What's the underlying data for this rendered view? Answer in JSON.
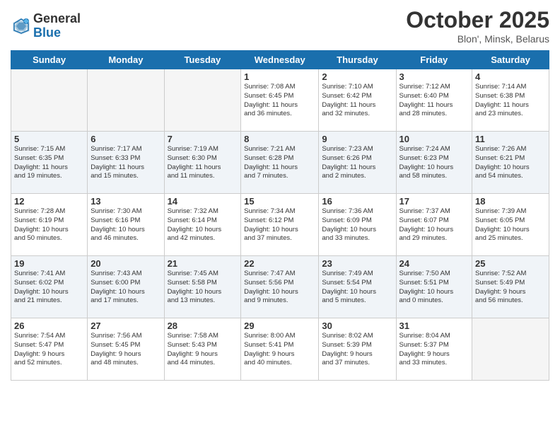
{
  "header": {
    "logo_general": "General",
    "logo_blue": "Blue",
    "month_title": "October 2025",
    "location": "Blon', Minsk, Belarus"
  },
  "days_of_week": [
    "Sunday",
    "Monday",
    "Tuesday",
    "Wednesday",
    "Thursday",
    "Friday",
    "Saturday"
  ],
  "weeks": [
    {
      "days": [
        {
          "num": "",
          "info": ""
        },
        {
          "num": "",
          "info": ""
        },
        {
          "num": "",
          "info": ""
        },
        {
          "num": "1",
          "info": "Sunrise: 7:08 AM\nSunset: 6:45 PM\nDaylight: 11 hours\nand 36 minutes."
        },
        {
          "num": "2",
          "info": "Sunrise: 7:10 AM\nSunset: 6:42 PM\nDaylight: 11 hours\nand 32 minutes."
        },
        {
          "num": "3",
          "info": "Sunrise: 7:12 AM\nSunset: 6:40 PM\nDaylight: 11 hours\nand 28 minutes."
        },
        {
          "num": "4",
          "info": "Sunrise: 7:14 AM\nSunset: 6:38 PM\nDaylight: 11 hours\nand 23 minutes."
        }
      ]
    },
    {
      "days": [
        {
          "num": "5",
          "info": "Sunrise: 7:15 AM\nSunset: 6:35 PM\nDaylight: 11 hours\nand 19 minutes."
        },
        {
          "num": "6",
          "info": "Sunrise: 7:17 AM\nSunset: 6:33 PM\nDaylight: 11 hours\nand 15 minutes."
        },
        {
          "num": "7",
          "info": "Sunrise: 7:19 AM\nSunset: 6:30 PM\nDaylight: 11 hours\nand 11 minutes."
        },
        {
          "num": "8",
          "info": "Sunrise: 7:21 AM\nSunset: 6:28 PM\nDaylight: 11 hours\nand 7 minutes."
        },
        {
          "num": "9",
          "info": "Sunrise: 7:23 AM\nSunset: 6:26 PM\nDaylight: 11 hours\nand 2 minutes."
        },
        {
          "num": "10",
          "info": "Sunrise: 7:24 AM\nSunset: 6:23 PM\nDaylight: 10 hours\nand 58 minutes."
        },
        {
          "num": "11",
          "info": "Sunrise: 7:26 AM\nSunset: 6:21 PM\nDaylight: 10 hours\nand 54 minutes."
        }
      ]
    },
    {
      "days": [
        {
          "num": "12",
          "info": "Sunrise: 7:28 AM\nSunset: 6:19 PM\nDaylight: 10 hours\nand 50 minutes."
        },
        {
          "num": "13",
          "info": "Sunrise: 7:30 AM\nSunset: 6:16 PM\nDaylight: 10 hours\nand 46 minutes."
        },
        {
          "num": "14",
          "info": "Sunrise: 7:32 AM\nSunset: 6:14 PM\nDaylight: 10 hours\nand 42 minutes."
        },
        {
          "num": "15",
          "info": "Sunrise: 7:34 AM\nSunset: 6:12 PM\nDaylight: 10 hours\nand 37 minutes."
        },
        {
          "num": "16",
          "info": "Sunrise: 7:36 AM\nSunset: 6:09 PM\nDaylight: 10 hours\nand 33 minutes."
        },
        {
          "num": "17",
          "info": "Sunrise: 7:37 AM\nSunset: 6:07 PM\nDaylight: 10 hours\nand 29 minutes."
        },
        {
          "num": "18",
          "info": "Sunrise: 7:39 AM\nSunset: 6:05 PM\nDaylight: 10 hours\nand 25 minutes."
        }
      ]
    },
    {
      "days": [
        {
          "num": "19",
          "info": "Sunrise: 7:41 AM\nSunset: 6:02 PM\nDaylight: 10 hours\nand 21 minutes."
        },
        {
          "num": "20",
          "info": "Sunrise: 7:43 AM\nSunset: 6:00 PM\nDaylight: 10 hours\nand 17 minutes."
        },
        {
          "num": "21",
          "info": "Sunrise: 7:45 AM\nSunset: 5:58 PM\nDaylight: 10 hours\nand 13 minutes."
        },
        {
          "num": "22",
          "info": "Sunrise: 7:47 AM\nSunset: 5:56 PM\nDaylight: 10 hours\nand 9 minutes."
        },
        {
          "num": "23",
          "info": "Sunrise: 7:49 AM\nSunset: 5:54 PM\nDaylight: 10 hours\nand 5 minutes."
        },
        {
          "num": "24",
          "info": "Sunrise: 7:50 AM\nSunset: 5:51 PM\nDaylight: 10 hours\nand 0 minutes."
        },
        {
          "num": "25",
          "info": "Sunrise: 7:52 AM\nSunset: 5:49 PM\nDaylight: 9 hours\nand 56 minutes."
        }
      ]
    },
    {
      "days": [
        {
          "num": "26",
          "info": "Sunrise: 7:54 AM\nSunset: 5:47 PM\nDaylight: 9 hours\nand 52 minutes."
        },
        {
          "num": "27",
          "info": "Sunrise: 7:56 AM\nSunset: 5:45 PM\nDaylight: 9 hours\nand 48 minutes."
        },
        {
          "num": "28",
          "info": "Sunrise: 7:58 AM\nSunset: 5:43 PM\nDaylight: 9 hours\nand 44 minutes."
        },
        {
          "num": "29",
          "info": "Sunrise: 8:00 AM\nSunset: 5:41 PM\nDaylight: 9 hours\nand 40 minutes."
        },
        {
          "num": "30",
          "info": "Sunrise: 8:02 AM\nSunset: 5:39 PM\nDaylight: 9 hours\nand 37 minutes."
        },
        {
          "num": "31",
          "info": "Sunrise: 8:04 AM\nSunset: 5:37 PM\nDaylight: 9 hours\nand 33 minutes."
        },
        {
          "num": "",
          "info": ""
        }
      ]
    }
  ]
}
